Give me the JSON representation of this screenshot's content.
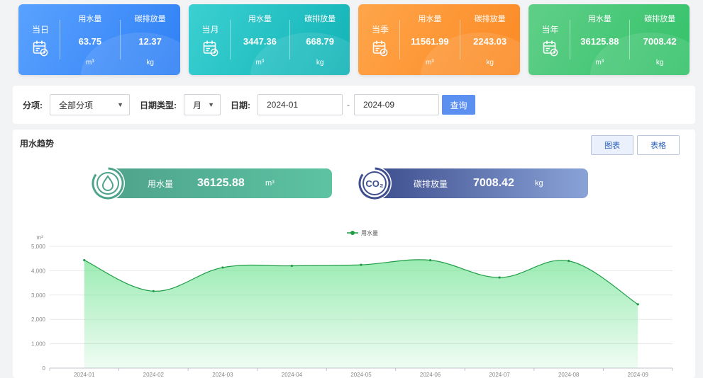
{
  "cards": [
    {
      "period": "当日",
      "water_label": "用水量",
      "water_value": "63.75",
      "water_unit": "m³",
      "carbon_label": "碳排放量",
      "carbon_value": "12.37",
      "carbon_unit": "kg",
      "color": "#3f8ef7"
    },
    {
      "period": "当月",
      "water_label": "用水量",
      "water_value": "3447.36",
      "water_unit": "m³",
      "carbon_label": "碳排放量",
      "carbon_value": "668.79",
      "carbon_unit": "kg",
      "color": "#1bbdc0"
    },
    {
      "period": "当季",
      "water_label": "用水量",
      "water_value": "11561.99",
      "water_unit": "m³",
      "carbon_label": "碳排放量",
      "carbon_value": "2243.03",
      "carbon_unit": "kg",
      "color": "#fc9532"
    },
    {
      "period": "当年",
      "water_label": "用水量",
      "water_value": "36125.88",
      "water_unit": "m³",
      "carbon_label": "碳排放量",
      "carbon_value": "7008.42",
      "carbon_unit": "kg",
      "color": "#43c776"
    }
  ],
  "filter": {
    "item_label": "分项:",
    "item_value": "全部分项",
    "date_type_label": "日期类型:",
    "date_type_value": "月",
    "date_label": "日期:",
    "start_date": "2024-01",
    "separator": "-",
    "end_date": "2024-09",
    "query_label": "查询"
  },
  "panel": {
    "title": "用水趋势",
    "chart_button": "图表",
    "table_button": "表格"
  },
  "summary": {
    "water_label": "用水量",
    "water_value": "36125.88",
    "water_unit": "m³",
    "co2_badge": "CO₂",
    "co2_label": "碳排放量",
    "co2_value": "7008.42",
    "co2_unit": "kg"
  },
  "chart_data": {
    "type": "area",
    "x": [
      "2024-01",
      "2024-02",
      "2024-03",
      "2024-04",
      "2024-05",
      "2024-06",
      "2024-07",
      "2024-08",
      "2024-09"
    ],
    "series": [
      {
        "name": "用水量",
        "values": [
          4430,
          3160,
          4130,
          4200,
          4240,
          4430,
          3720,
          4400,
          2620
        ],
        "color": "#1e9d46",
        "fill": "#7be59a"
      }
    ],
    "ylabel": "m³",
    "yticks": [
      "0",
      "1,000",
      "2,000",
      "3,000",
      "4,000",
      "5,000"
    ],
    "ylim": [
      0,
      5000
    ],
    "grid": true,
    "legend": "top-center"
  }
}
